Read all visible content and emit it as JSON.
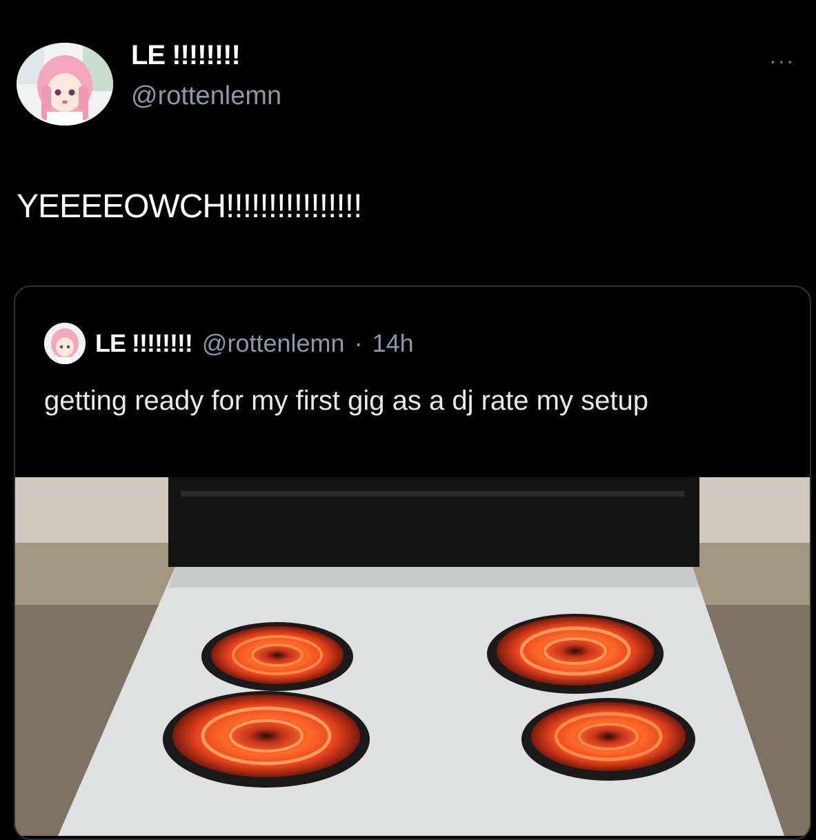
{
  "tweet": {
    "display_name": "LE !!!!!!!!",
    "handle": "@rottenlemn",
    "more_label": "...",
    "text": "YEEEEOWCH!!!!!!!!!!!!!!!!"
  },
  "quoted_tweet": {
    "display_name": "LE !!!!!!!!",
    "handle": "@rottenlemn",
    "separator": "·",
    "time": "14h",
    "text": "getting ready for my first gig as a dj rate my setup"
  },
  "icons": {
    "avatar": "anime-girl-avatar",
    "more": "more-options-icon"
  },
  "colors": {
    "background": "#000000",
    "text": "#e7e9ea",
    "secondary_text": "#8b98a5",
    "border": "#2f3336"
  }
}
